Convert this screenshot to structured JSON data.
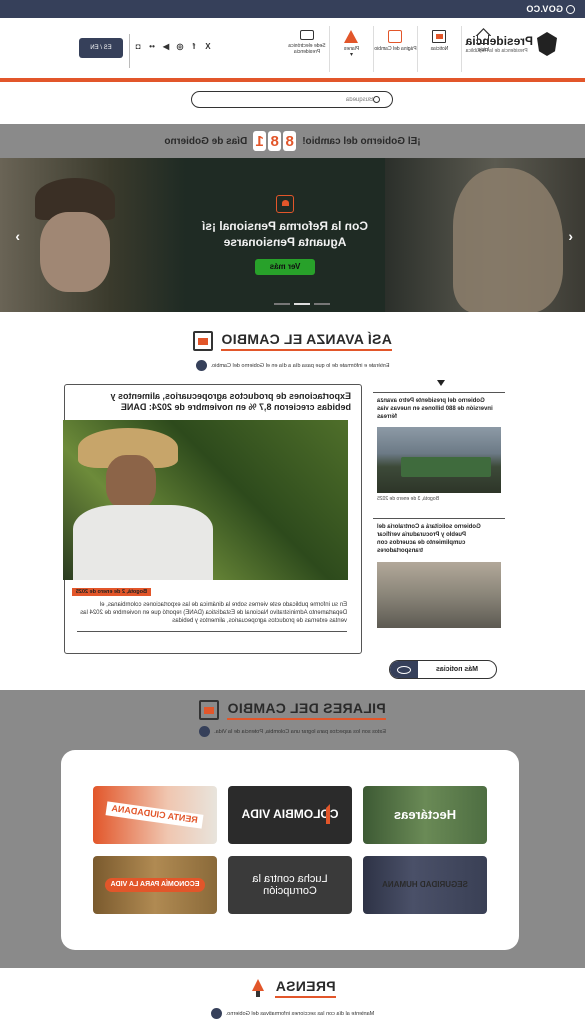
{
  "govco": {
    "label": "GOV.CO"
  },
  "header": {
    "brand_name": "Presidencia",
    "brand_sub": "Presidencia de la República",
    "nav": [
      {
        "label": "Inicio",
        "icon": "home-icon"
      },
      {
        "label": "Noticias",
        "icon": "news-icon"
      },
      {
        "label": "Página del Cambio",
        "icon": "page-icon"
      },
      {
        "label": "Planes",
        "icon": "tree-icon"
      },
      {
        "label": "Sede electrónica Presidencia",
        "icon": "monitor-icon"
      }
    ],
    "social": [
      "X",
      "f",
      "◎",
      "▶",
      "••",
      "◘"
    ],
    "lang_button": "ES / EN"
  },
  "search": {
    "placeholder": "Búsqueda"
  },
  "counter": {
    "prefix": "¡El Gobierno del cambio!",
    "digits": [
      "8",
      "8",
      "1"
    ],
    "suffix": "Días de Gobierno"
  },
  "hero": {
    "title": "Con la Reforma Pensional ¡sí Aguanta Pensionarse",
    "button": "Ver más"
  },
  "avanza": {
    "title": "ASÍ AVANZA EL CAMBIO",
    "subtitle": "Entérate e infórmate de lo que pasa día a día en el Gobierno del Cambio."
  },
  "main_news": {
    "title": "Exportaciones de productos agropecuarios, alimentos y bebidas crecieron 8,7 % en noviembre de 2024: DANE",
    "date": "Bogotá, 2 de enero de 2025",
    "text": "En su informe publicado este viernes sobre la dinámica de las exportaciones colombianas, el Departamento Administrativo Nacional de Estadística (DANE) reportó que en noviembre de 2024 las ventas externas de productos agropecuarios, alimentos y bebidas"
  },
  "side_news": [
    {
      "title": "Gobierno del presidente Petro avanza inversión de 880 billones en nuevas vías férreas",
      "date": "Bogotá, 3 de enero de 2025"
    },
    {
      "title": "Gobierno solicitará a Contraloría del Pueblo y Procuraduría verificar cumplimiento de acuerdos con transportadores",
      "date": ""
    }
  ],
  "more_news": "Más noticias",
  "pilares": {
    "title": "PILARES DEL CAMBIO",
    "subtitle": "Estos son los aspectos para lograr una Colombia, Potencia de la Vida.",
    "tiles": [
      {
        "label": "RENTA CIUDADANA"
      },
      {
        "label": "COLOMBIA VIDA"
      },
      {
        "label": "Hectáreas"
      },
      {
        "label": "ECONOMÍA PARA LA VIDA"
      },
      {
        "label": "Lucha contra la Corrupción"
      },
      {
        "label": "SEGURIDAD HUMANA"
      }
    ]
  },
  "prensa": {
    "title": "PRENSA",
    "subtitle": "Mantente al día con las secciones informativas del Gobierno."
  }
}
